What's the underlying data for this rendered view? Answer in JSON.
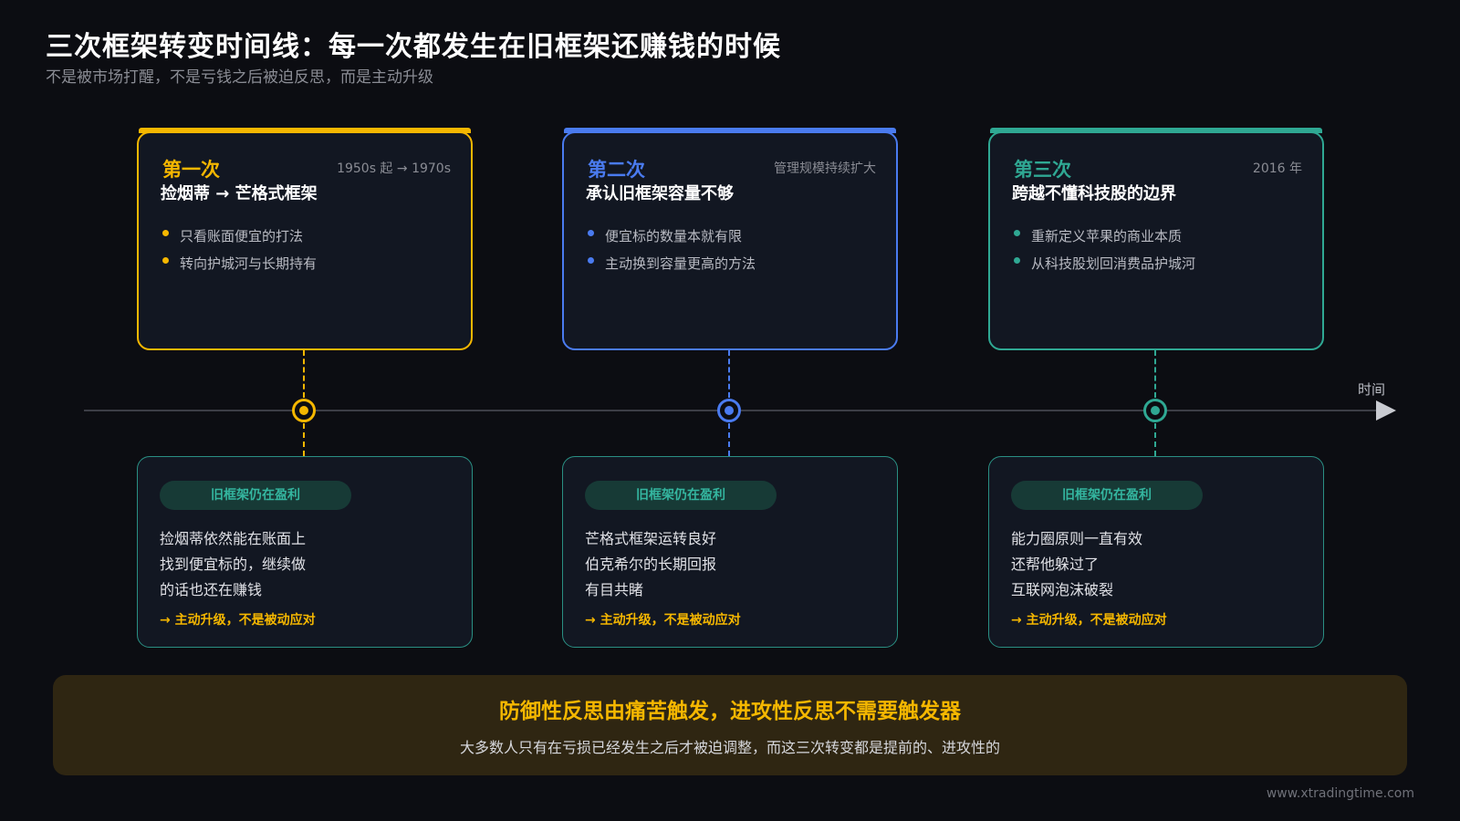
{
  "header": {
    "title": "三次框架转变时间线：每一次都发生在旧框架还赚钱的时候",
    "subtitle": "不是被市场打醒，不是亏钱之后被迫反思，而是主动升级"
  },
  "timeline": {
    "axis_label": "时间"
  },
  "stages": [
    {
      "ordinal": "第一次",
      "date": "1950s 起 → 1970s",
      "name": "捡烟蒂 → 芒格式框架",
      "bullets": [
        "只看账面便宜的打法",
        "转向护城河与长期持有"
      ],
      "color": "#f5b700",
      "status": "旧框架仍在盈利",
      "lines": [
        "捡烟蒂依然能在账面上",
        "找到便宜标的，继续做",
        "的话也还在赚钱"
      ],
      "takeaway": "→ 主动升级，不是被动应对"
    },
    {
      "ordinal": "第二次",
      "date": "管理规模持续扩大",
      "name": "承认旧框架容量不够",
      "bullets": [
        "便宜标的数量本就有限",
        "主动换到容量更高的方法"
      ],
      "color": "#4a7bf0",
      "status": "旧框架仍在盈利",
      "lines": [
        "芒格式框架运转良好",
        "伯克希尔的长期回报",
        "有目共睹"
      ],
      "takeaway": "→ 主动升级，不是被动应对"
    },
    {
      "ordinal": "第三次",
      "date": "2016 年",
      "name": "跨越不懂科技股的边界",
      "bullets": [
        "重新定义苹果的商业本质",
        "从科技股划回消费品护城河"
      ],
      "color": "#2fa893",
      "status": "旧框架仍在盈利",
      "lines": [
        "能力圈原则一直有效",
        "还帮他躲过了",
        "互联网泡沫破裂"
      ],
      "takeaway": "→ 主动升级，不是被动应对"
    }
  ],
  "summary": {
    "headline": "防御性反思由痛苦触发，进攻性反思不需要触发器",
    "body": "大多数人只有在亏损已经发生之后才被迫调整，而这三次转变都是提前的、进攻性的"
  },
  "footer": {
    "site": "www.xtradingtime.com"
  }
}
